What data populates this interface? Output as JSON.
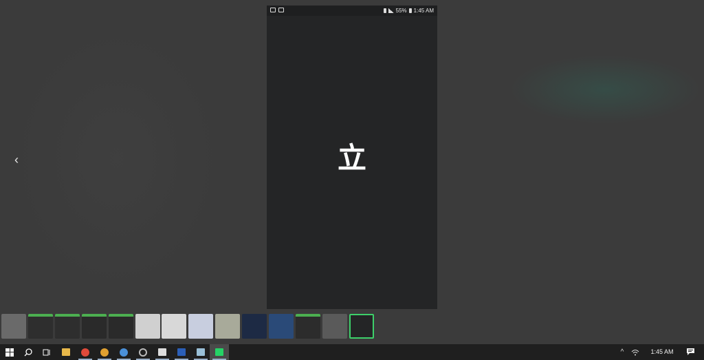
{
  "phone": {
    "status": {
      "battery_percent": "55%",
      "time": "1:45 AM"
    },
    "logo_glyph": "立"
  },
  "navigation": {
    "prev_glyph": "‹"
  },
  "filmstrip": {
    "thumbnails": [
      {
        "name": "photo",
        "color": "#6a6a6a",
        "bar": false
      },
      {
        "name": "app-screen",
        "color": "#2e2e2e",
        "bar": true
      },
      {
        "name": "app-screen",
        "color": "#2e2e2e",
        "bar": true
      },
      {
        "name": "app-screen",
        "color": "#2a2a2a",
        "bar": true
      },
      {
        "name": "app-screen",
        "color": "#2a2a2a",
        "bar": true
      },
      {
        "name": "light-screen",
        "color": "#d0d0d0",
        "bar": false
      },
      {
        "name": "light-screen",
        "color": "#d8d8d8",
        "bar": false
      },
      {
        "name": "light-screen",
        "color": "#c8cedf",
        "bar": false
      },
      {
        "name": "photo",
        "color": "#a8aa9a",
        "bar": false
      },
      {
        "name": "dark-blue-screen",
        "color": "#1d2a44",
        "bar": false
      },
      {
        "name": "dark-blue-screen",
        "color": "#2a4a78",
        "bar": false
      },
      {
        "name": "app-screen",
        "color": "#2c2c2c",
        "bar": true
      },
      {
        "name": "light-screen",
        "color": "#5a5a5a",
        "bar": false
      },
      {
        "name": "current-screen",
        "color": "#242526",
        "bar": false
      }
    ],
    "selected_index": 13
  },
  "taskbar": {
    "items": [
      {
        "name": "start-button",
        "icon": "windows-icon"
      },
      {
        "name": "search-button",
        "icon": "search-icon"
      },
      {
        "name": "task-view-button",
        "icon": "task-view-icon"
      },
      {
        "name": "file-explorer-button",
        "icon": "folder-icon",
        "color": "#e8b84a"
      },
      {
        "name": "chrome-button-1",
        "icon": "chrome-icon",
        "color": "#e04a3a"
      },
      {
        "name": "chrome-button-2",
        "icon": "chrome-icon",
        "color": "#e0a030"
      },
      {
        "name": "chrome-button-3",
        "icon": "chrome-icon",
        "color": "#4a90d9"
      },
      {
        "name": "settings-app-button",
        "icon": "gear-icon",
        "color": "#bbbbbb"
      },
      {
        "name": "terminal-button",
        "icon": "terminal-icon",
        "color": "#dddddd"
      },
      {
        "name": "word-button",
        "icon": "word-icon",
        "color": "#2b5fb8"
      },
      {
        "name": "notes-button",
        "icon": "notes-icon",
        "color": "#9ac0d8"
      },
      {
        "name": "whatsapp-button",
        "icon": "whatsapp-icon",
        "color": "#25d366"
      }
    ],
    "active_index": 11,
    "tray": {
      "chevron": "^",
      "clock": "1:45 AM"
    }
  }
}
